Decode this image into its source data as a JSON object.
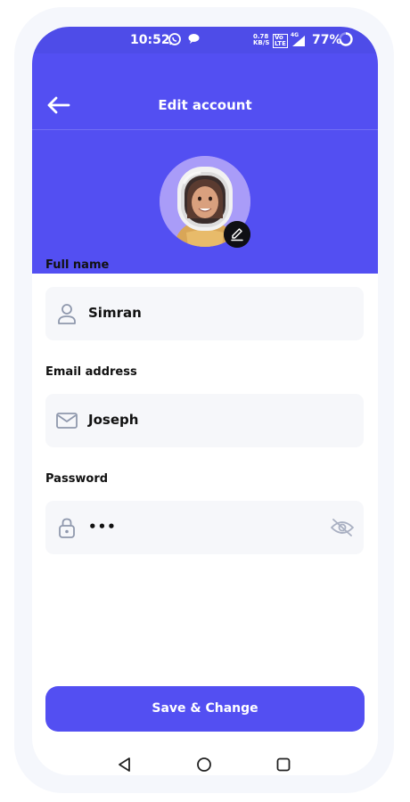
{
  "status_bar": {
    "time": "10:52",
    "net_speed_top": "0.78",
    "net_speed_unit": "KB/S",
    "volte_top": "Vo",
    "volte_bottom": "LTE",
    "network": "4G",
    "battery": "77%"
  },
  "header": {
    "title": "Edit account",
    "back_icon": "arrow-left-icon",
    "edit_icon": "pencil-icon"
  },
  "form": {
    "full_name": {
      "label": "Full name",
      "value": "Simran",
      "icon": "user-icon"
    },
    "email": {
      "label": "Email address",
      "value": "Joseph",
      "icon": "mail-icon"
    },
    "password": {
      "label": "Password",
      "value": "•••",
      "icon": "lock-icon",
      "toggle_icon": "eye-off-icon"
    }
  },
  "save_button": {
    "label": "Save & Change"
  },
  "nav_bar": {
    "back": "triangle-back-icon",
    "home": "circle-home-icon",
    "recents": "square-recents-icon"
  },
  "colors": {
    "accent": "#534ff2",
    "status_bar": "#4e4ce8",
    "field_bg": "#f6f7fa",
    "icon_grey": "#8f98ad",
    "avatar_ring": "#a99cf8"
  }
}
